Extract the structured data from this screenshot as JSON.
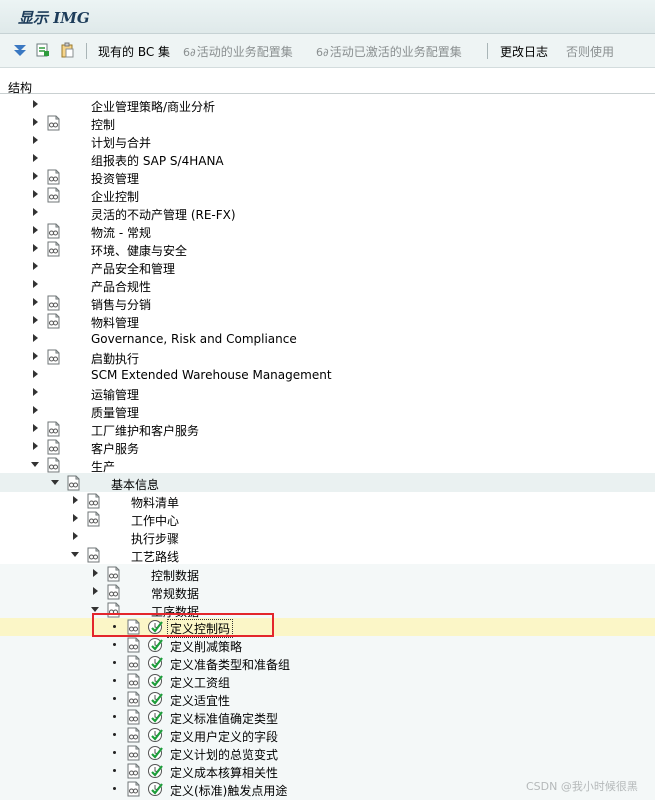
{
  "window": {
    "title": "显示 IMG"
  },
  "toolbar": {
    "existing_bc_sets": "现有的 BC 集",
    "active_bc_sets": "活动的业务配置集",
    "activated_bc_sets": "活动已激活的业务配置集",
    "change_log": "更改日志",
    "deprecated": "否则使用"
  },
  "structure": {
    "header": "结构"
  },
  "tree": {
    "top_nodes": [
      {
        "label": "企业管理策略/商业分析",
        "icon": false
      },
      {
        "label": "控制",
        "icon": true
      },
      {
        "label": "计划与合并",
        "icon": false
      },
      {
        "label": "组报表的 SAP S/4HANA",
        "icon": false
      },
      {
        "label": "投资管理",
        "icon": true
      },
      {
        "label": "企业控制",
        "icon": true
      },
      {
        "label": "灵活的不动产管理 (RE-FX)",
        "icon": false
      },
      {
        "label": "物流 - 常规",
        "icon": true
      },
      {
        "label": "环境、健康与安全",
        "icon": true
      },
      {
        "label": "产品安全和管理",
        "icon": false
      },
      {
        "label": "产品合规性",
        "icon": false
      },
      {
        "label": "销售与分销",
        "icon": true
      },
      {
        "label": "物料管理",
        "icon": true
      },
      {
        "label": "Governance, Risk and Compliance",
        "icon": false
      },
      {
        "label": "启勤执行",
        "icon": true
      },
      {
        "label": "SCM Extended Warehouse Management",
        "icon": false
      },
      {
        "label": "运输管理",
        "icon": false
      },
      {
        "label": "质量管理",
        "icon": false
      },
      {
        "label": "工厂维护和客户服务",
        "icon": true
      },
      {
        "label": "客户服务",
        "icon": true
      },
      {
        "label": "生产",
        "icon": true
      }
    ],
    "basic_data": "基本信息",
    "basic_children": [
      {
        "label": "物料清单"
      },
      {
        "label": "工作中心"
      },
      {
        "label": "执行步骤"
      },
      {
        "label": "工艺路线"
      }
    ],
    "routing_children": [
      {
        "label": "控制数据"
      },
      {
        "label": "常规数据"
      },
      {
        "label": "工序数据"
      }
    ],
    "operation_activities": [
      {
        "label": "定义控制码"
      },
      {
        "label": "定义削减策略"
      },
      {
        "label": "定义准备类型和准备组"
      },
      {
        "label": "定义工资组"
      },
      {
        "label": "定义适宜性"
      },
      {
        "label": "定义标准值确定类型"
      },
      {
        "label": "定义用户定义的字段"
      },
      {
        "label": "定义计划的总览变式"
      },
      {
        "label": "定义成本核算相关性"
      },
      {
        "label": "定义(标准)触发点用途"
      }
    ]
  },
  "watermark": "CSDN @我小时候很黑",
  "colors": {
    "highlight_row": "#fbf6c7",
    "selection_border": "#e3262c",
    "check_green": "#1d9e3a"
  }
}
